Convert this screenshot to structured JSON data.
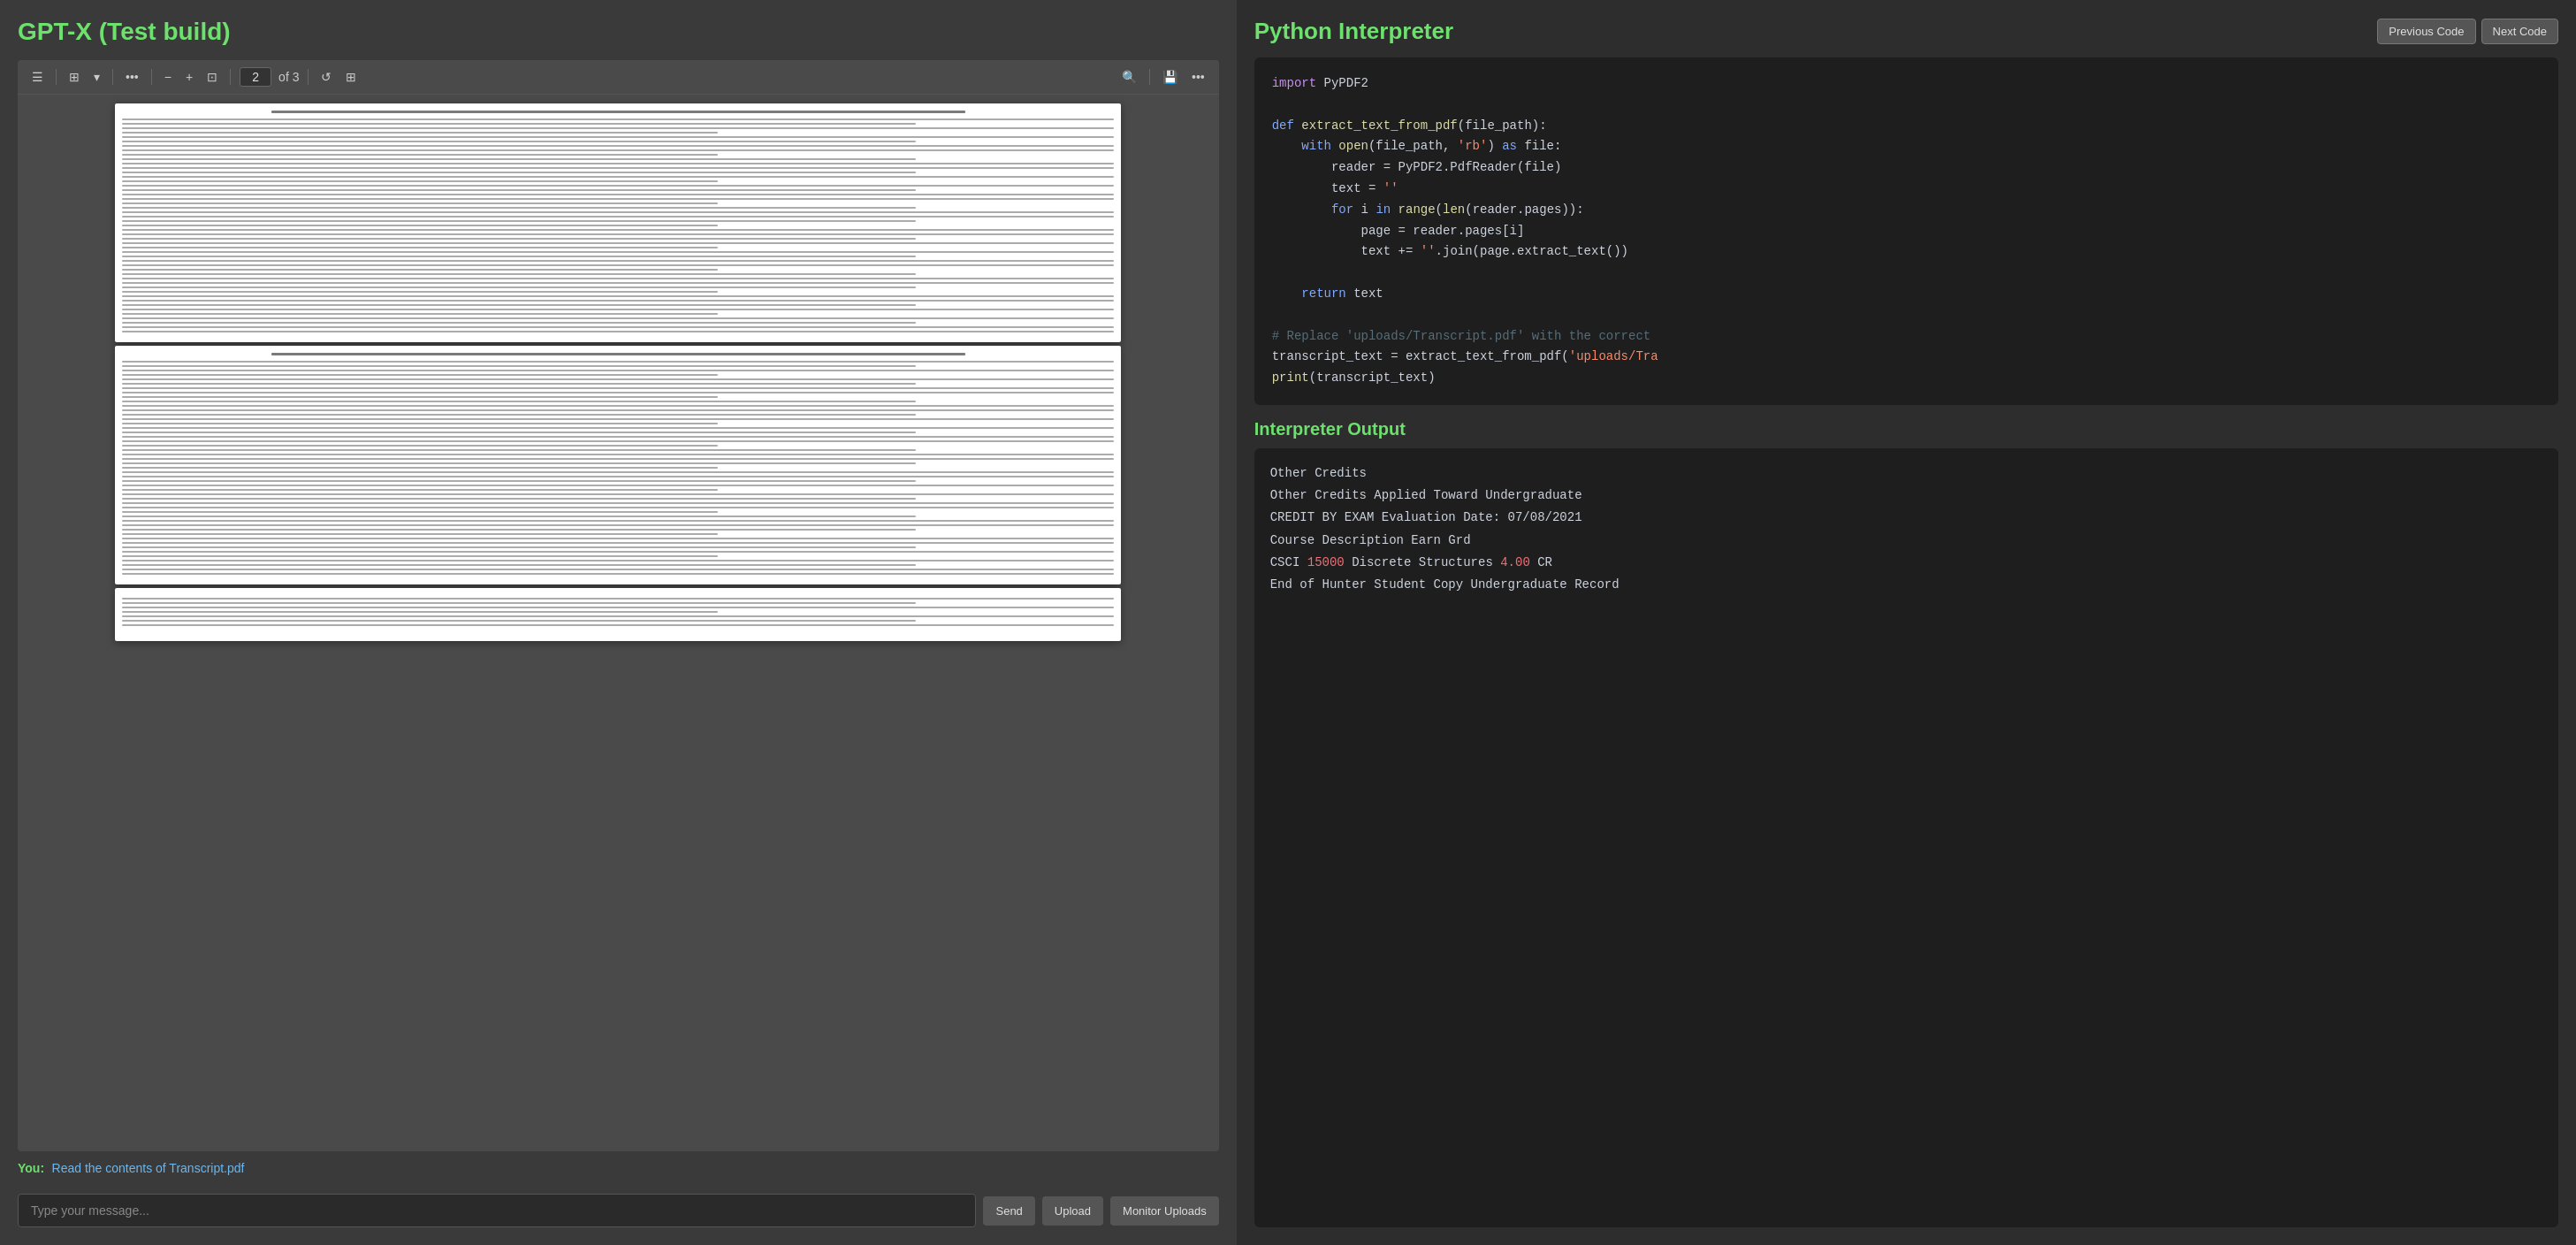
{
  "app": {
    "title": "GPT-X (Test build)"
  },
  "pdf_viewer": {
    "toolbar": {
      "page_current": "2",
      "page_total": "of 3"
    }
  },
  "chat": {
    "you_label": "You:",
    "you_message": "Read the contents of Transcript.pdf",
    "input_placeholder": "Type your message...",
    "send_label": "Send",
    "upload_label": "Upload",
    "monitor_label": "Monitor Uploads"
  },
  "interpreter": {
    "title": "Python Interpreter",
    "prev_code": "Previous Code",
    "next_code": "Next Code"
  },
  "output": {
    "title": "Interpreter Output",
    "lines": [
      {
        "text": "Other Credits",
        "type": "normal"
      },
      {
        "text": "Other Credits Applied Toward Undergraduate",
        "type": "normal"
      },
      {
        "text": "CREDIT BY EXAM Evaluation Date: 07/08/2021",
        "type": "normal"
      },
      {
        "text": "Course Description Earn Grd",
        "type": "normal"
      },
      {
        "text": "CSCI 15000 Discrete Structures 4.00 CR",
        "type": "highlight"
      },
      {
        "text": "End of Hunter Student Copy Undergraduate Record",
        "type": "normal"
      }
    ]
  }
}
